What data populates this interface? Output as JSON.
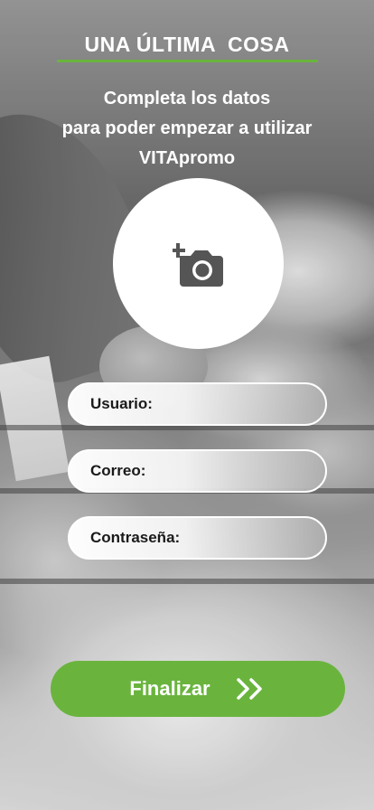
{
  "header": {
    "title": "UNA ÚLTIMA  COSA",
    "subtitle_lines": [
      "Completa los datos",
      "para poder empezar a utilizar",
      "VITApromo"
    ]
  },
  "photo": {
    "icon": "add-photo-icon"
  },
  "form": {
    "usuario_label": "Usuario:",
    "correo_label": "Correo:",
    "password_label": "Contraseña:"
  },
  "actions": {
    "finish_label": "Finalizar",
    "finish_icon": "double-chevron-right-icon"
  },
  "colors": {
    "accent": "#6ab43e",
    "icon": "#555555"
  }
}
